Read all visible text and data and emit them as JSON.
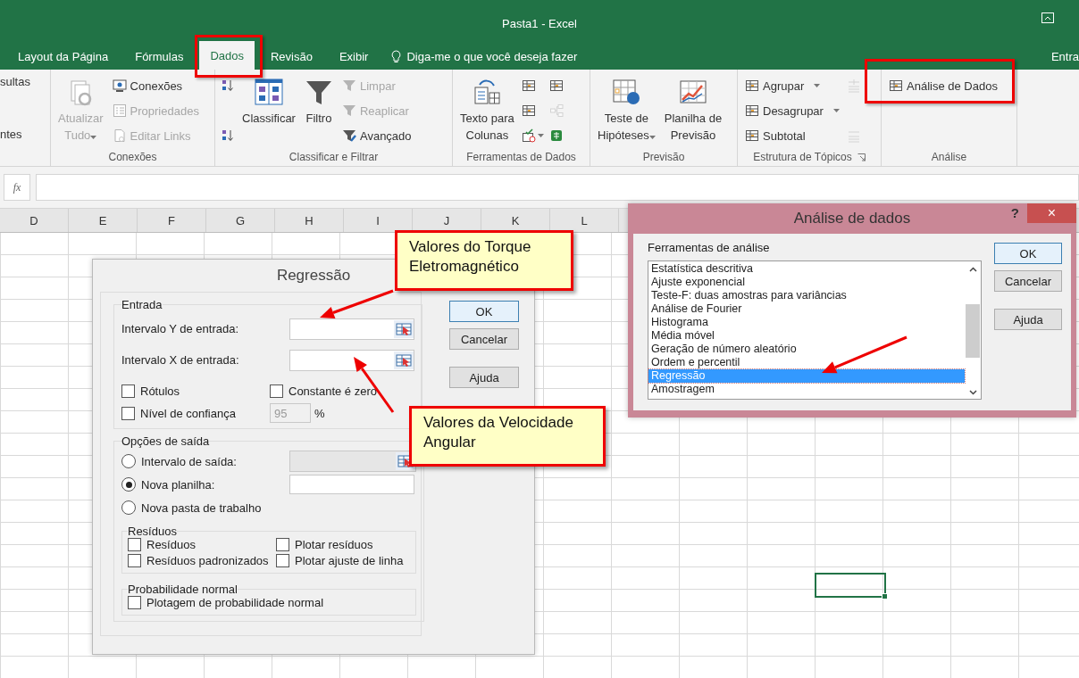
{
  "window": {
    "title": "Pasta1 - Excel"
  },
  "tabs": [
    {
      "label": "Layout da Página",
      "selected": false
    },
    {
      "label": "Fórmulas",
      "selected": false
    },
    {
      "label": "Dados",
      "selected": true
    },
    {
      "label": "Revisão",
      "selected": false
    },
    {
      "label": "Exibir",
      "selected": false
    }
  ],
  "tell_me": {
    "placeholder": "Diga-me o que você deseja fazer"
  },
  "account": "Entra",
  "ribbon": {
    "partial_group": [
      "sultas",
      "ntes"
    ],
    "groups": [
      {
        "label": "Conexões",
        "launcher": false,
        "columns": [
          [
            {
              "kind": "large",
              "lines": [
                "Atualizar",
                "Tudo"
              ],
              "disabled": true,
              "dropdown": true
            }
          ],
          [
            {
              "kind": "small",
              "label": "Conexões",
              "disabled": false,
              "dropdown": false
            },
            {
              "kind": "small",
              "label": "Propriedades",
              "disabled": true,
              "dropdown": false
            },
            {
              "kind": "small",
              "label": "Editar Links",
              "disabled": true,
              "dropdown": false
            }
          ]
        ]
      },
      {
        "label": "Classificar e Filtrar",
        "launcher": false,
        "columns": [
          [
            {
              "kind": "icon",
              "disabled": false,
              "dropdown": false
            },
            {
              "kind": "icon",
              "disabled": false,
              "dropdown": false
            }
          ],
          [
            {
              "kind": "large",
              "lines": [
                "Classificar"
              ],
              "disabled": false,
              "dropdown": false
            }
          ],
          [
            {
              "kind": "large",
              "lines": [
                "Filtro"
              ],
              "disabled": false,
              "dropdown": false
            }
          ],
          [
            {
              "kind": "small",
              "label": "Limpar",
              "disabled": true,
              "dropdown": false
            },
            {
              "kind": "small",
              "label": "Reaplicar",
              "disabled": true,
              "dropdown": false
            },
            {
              "kind": "small",
              "label": "Avançado",
              "disabled": false,
              "dropdown": false
            }
          ]
        ]
      },
      {
        "label": "Ferramentas de Dados",
        "launcher": false,
        "columns": [
          [
            {
              "kind": "large",
              "lines": [
                "Texto para",
                "Colunas"
              ],
              "disabled": false,
              "dropdown": false
            }
          ],
          [
            {
              "kind": "icon",
              "disabled": false,
              "dropdown": false
            },
            {
              "kind": "icon",
              "disabled": false,
              "dropdown": false
            },
            {
              "kind": "icon",
              "disabled": false,
              "dropdown": true
            }
          ],
          [
            {
              "kind": "icon",
              "disabled": false,
              "dropdown": false
            },
            {
              "kind": "icon",
              "disabled": true,
              "dropdown": false
            },
            {
              "kind": "icon",
              "disabled": false,
              "dropdown": false
            }
          ]
        ]
      },
      {
        "label": "Previsão",
        "launcher": false,
        "columns": [
          [
            {
              "kind": "large",
              "lines": [
                "Teste de",
                "Hipóteses"
              ],
              "disabled": false,
              "dropdown": true
            }
          ],
          [
            {
              "kind": "large",
              "lines": [
                "Planilha de",
                "Previsão"
              ],
              "disabled": false,
              "dropdown": false
            }
          ]
        ]
      },
      {
        "label": "Estrutura de Tópicos",
        "launcher": true,
        "columns": [
          [
            {
              "kind": "small",
              "label": "Agrupar",
              "disabled": false,
              "dropdown": true
            },
            {
              "kind": "small",
              "label": "Desagrupar",
              "disabled": false,
              "dropdown": true
            },
            {
              "kind": "small",
              "label": "Subtotal",
              "disabled": false,
              "dropdown": false
            }
          ],
          [
            {
              "kind": "icon",
              "disabled": true,
              "dropdown": false
            },
            {
              "kind": "icon",
              "disabled": true,
              "dropdown": false
            }
          ]
        ]
      },
      {
        "label": "Análise",
        "launcher": false,
        "columns": [
          [
            {
              "kind": "small",
              "label": "Análise de Dados",
              "disabled": false,
              "dropdown": false
            }
          ]
        ]
      }
    ]
  },
  "formula_bar": {
    "function_label": "fx"
  },
  "sheet": {
    "columns": [
      "D",
      "E",
      "F",
      "G",
      "H",
      "I",
      "J",
      "K",
      "L"
    ]
  },
  "regression_dialog": {
    "title": "Regressão",
    "input_group": {
      "legend": "Entrada",
      "fields": [
        {
          "label": "Intervalo Y de entrada:"
        },
        {
          "label": "Intervalo X de entrada:"
        }
      ],
      "checks": [
        {
          "label": "Rótulos",
          "checked": false
        },
        {
          "label": "Constante é zero",
          "checked": false
        },
        {
          "label": "Nível de confiança",
          "checked": false
        }
      ],
      "confidence": "95",
      "percent": "%"
    },
    "output_group": {
      "legend": "Opções de saída",
      "options": [
        {
          "label": "Intervalo de saída:",
          "selected": false,
          "kind": "range"
        },
        {
          "label": "Nova planilha:",
          "selected": true,
          "kind": "text"
        },
        {
          "label": "Nova pasta de trabalho",
          "selected": false,
          "kind": "plain"
        }
      ],
      "residuals": {
        "legend": "Resíduos",
        "checks": [
          {
            "label": "Resíduos",
            "checked": false
          },
          {
            "label": "Plotar resíduos",
            "checked": false
          },
          {
            "label": "Resíduos padronizados",
            "checked": false
          },
          {
            "label": "Plotar ajuste de linha",
            "checked": false
          }
        ]
      },
      "normal": {
        "legend": "Probabilidade normal",
        "checks": [
          {
            "label": "Plotagem de probabilidade normal",
            "checked": false
          }
        ]
      }
    },
    "buttons": [
      {
        "label": "OK",
        "default": true
      },
      {
        "label": "Cancelar",
        "default": false
      },
      {
        "label": "Ajuda",
        "default": false
      }
    ]
  },
  "analysis_dialog": {
    "title": "Análise de dados",
    "help": "?",
    "close": "×",
    "list_label": "Ferramentas de análise",
    "items": [
      {
        "label": "Estatística descritiva",
        "selected": false
      },
      {
        "label": "Ajuste exponencial",
        "selected": false
      },
      {
        "label": "Teste-F: duas amostras para variâncias",
        "selected": false
      },
      {
        "label": "Análise de Fourier",
        "selected": false
      },
      {
        "label": "Histograma",
        "selected": false
      },
      {
        "label": "Média móvel",
        "selected": false
      },
      {
        "label": "Geração de número aleatório",
        "selected": false
      },
      {
        "label": "Ordem e percentil",
        "selected": false
      },
      {
        "label": "Regressão",
        "selected": true
      },
      {
        "label": "Amostragem",
        "selected": false
      }
    ],
    "buttons": [
      {
        "label": "OK",
        "default": true
      },
      {
        "label": "Cancelar",
        "default": false
      },
      {
        "label": "Ajuda",
        "default": false
      }
    ]
  },
  "callouts": [
    {
      "text": "Valores do Torque Eletromagnético"
    },
    {
      "text": "Valores da Velocidade Angular"
    }
  ]
}
